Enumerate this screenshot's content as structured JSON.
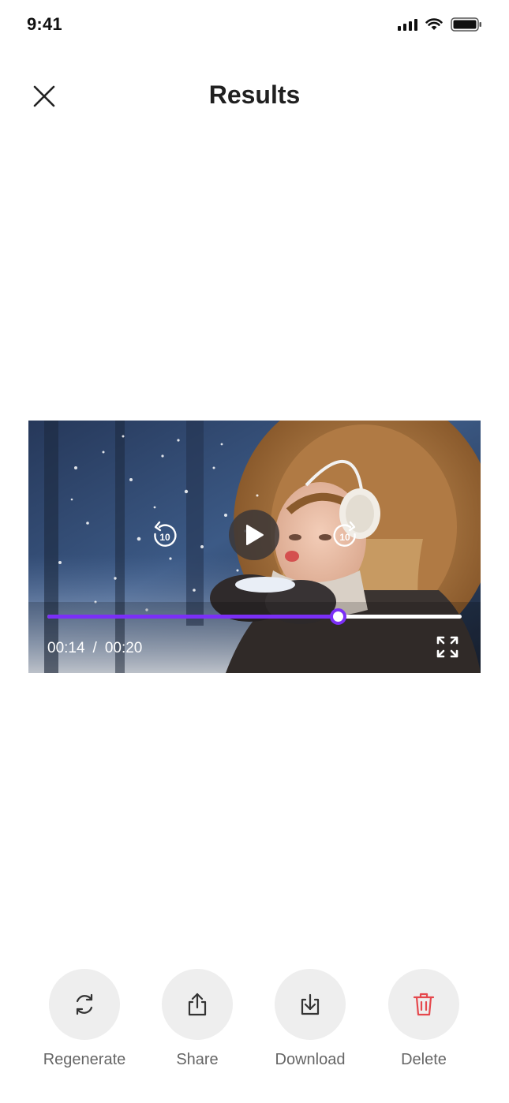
{
  "status_bar": {
    "time": "9:41"
  },
  "header": {
    "title": "Results"
  },
  "player": {
    "current_time": "00:14",
    "separator": "/",
    "duration": "00:20",
    "progress": 0.7,
    "rewind_seconds": "10",
    "forward_seconds": "10",
    "accent_color": "#7b2ff7"
  },
  "actions": [
    {
      "label": "Regenerate",
      "icon": "regenerate-icon",
      "color": "#333333"
    },
    {
      "label": "Share",
      "icon": "share-icon",
      "color": "#333333"
    },
    {
      "label": "Download",
      "icon": "download-icon",
      "color": "#333333"
    },
    {
      "label": "Delete",
      "icon": "trash-icon",
      "color": "#e5484d"
    }
  ]
}
